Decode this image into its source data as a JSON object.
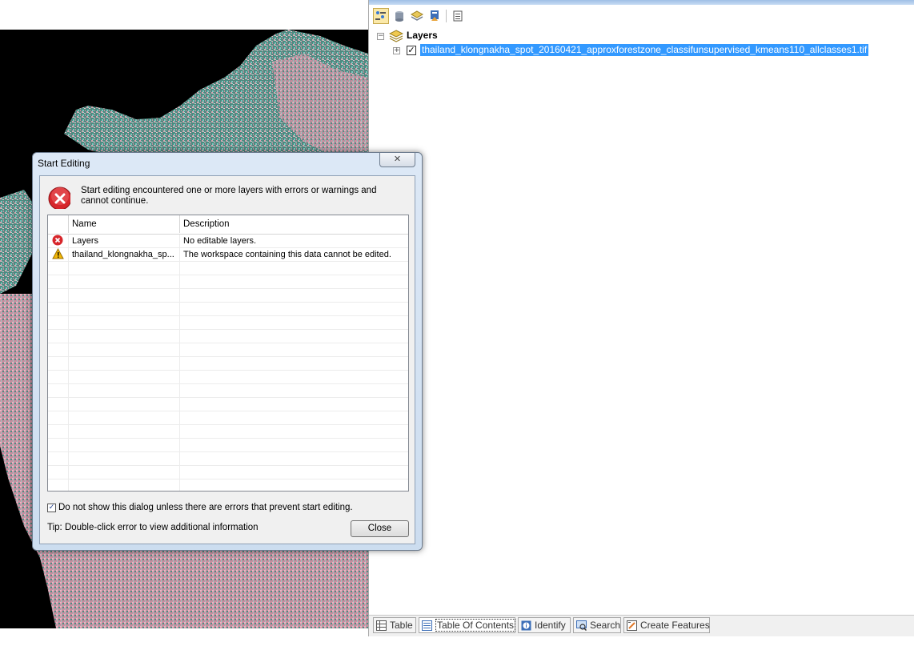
{
  "map": {
    "description_icon": "raster-map"
  },
  "toc": {
    "toolbar": {
      "buttons": [
        "list-by-drawing-order-icon",
        "list-by-source-icon",
        "list-by-visibility-icon",
        "list-by-selection-icon",
        "options-icon"
      ]
    },
    "tree": {
      "root_label": "Layers",
      "root_expander": "−",
      "layer_expander": "+",
      "layer_checked": "✓",
      "layer_name": "thailand_klongnakha_spot_20160421_approxforestzone_classifunsupervised_kmeans110_allclasses1.tif"
    },
    "tabs": [
      {
        "label": "Table",
        "icon": "table-icon",
        "active": false
      },
      {
        "label": "Table Of Contents",
        "icon": "toc-icon",
        "active": true
      },
      {
        "label": "Identify",
        "icon": "identify-icon",
        "active": false
      },
      {
        "label": "Search",
        "icon": "search-icon",
        "active": false
      },
      {
        "label": "Create Features",
        "icon": "create-features-icon",
        "active": false
      }
    ]
  },
  "dialog": {
    "title": "Start Editing",
    "close_glyph": "✕",
    "message": "Start editing encountered one or more layers with errors or warnings and cannot continue.",
    "columns": [
      "Name",
      "Description"
    ],
    "rows": [
      {
        "icon": "error-icon",
        "name": "Layers",
        "description": "No editable layers."
      },
      {
        "icon": "warning-icon",
        "name": "thailand_klongnakha_sp...",
        "description": "The workspace containing this data cannot be edited."
      }
    ],
    "dont_show_checked": "✓",
    "dont_show_label": "Do not show this dialog unless there are errors that prevent start editing.",
    "tip": "Tip: Double-click error to view additional information",
    "close_button": "Close"
  },
  "colors": {
    "selection": "#3399ff",
    "error": "#d7262b",
    "warning": "#f2b705"
  }
}
